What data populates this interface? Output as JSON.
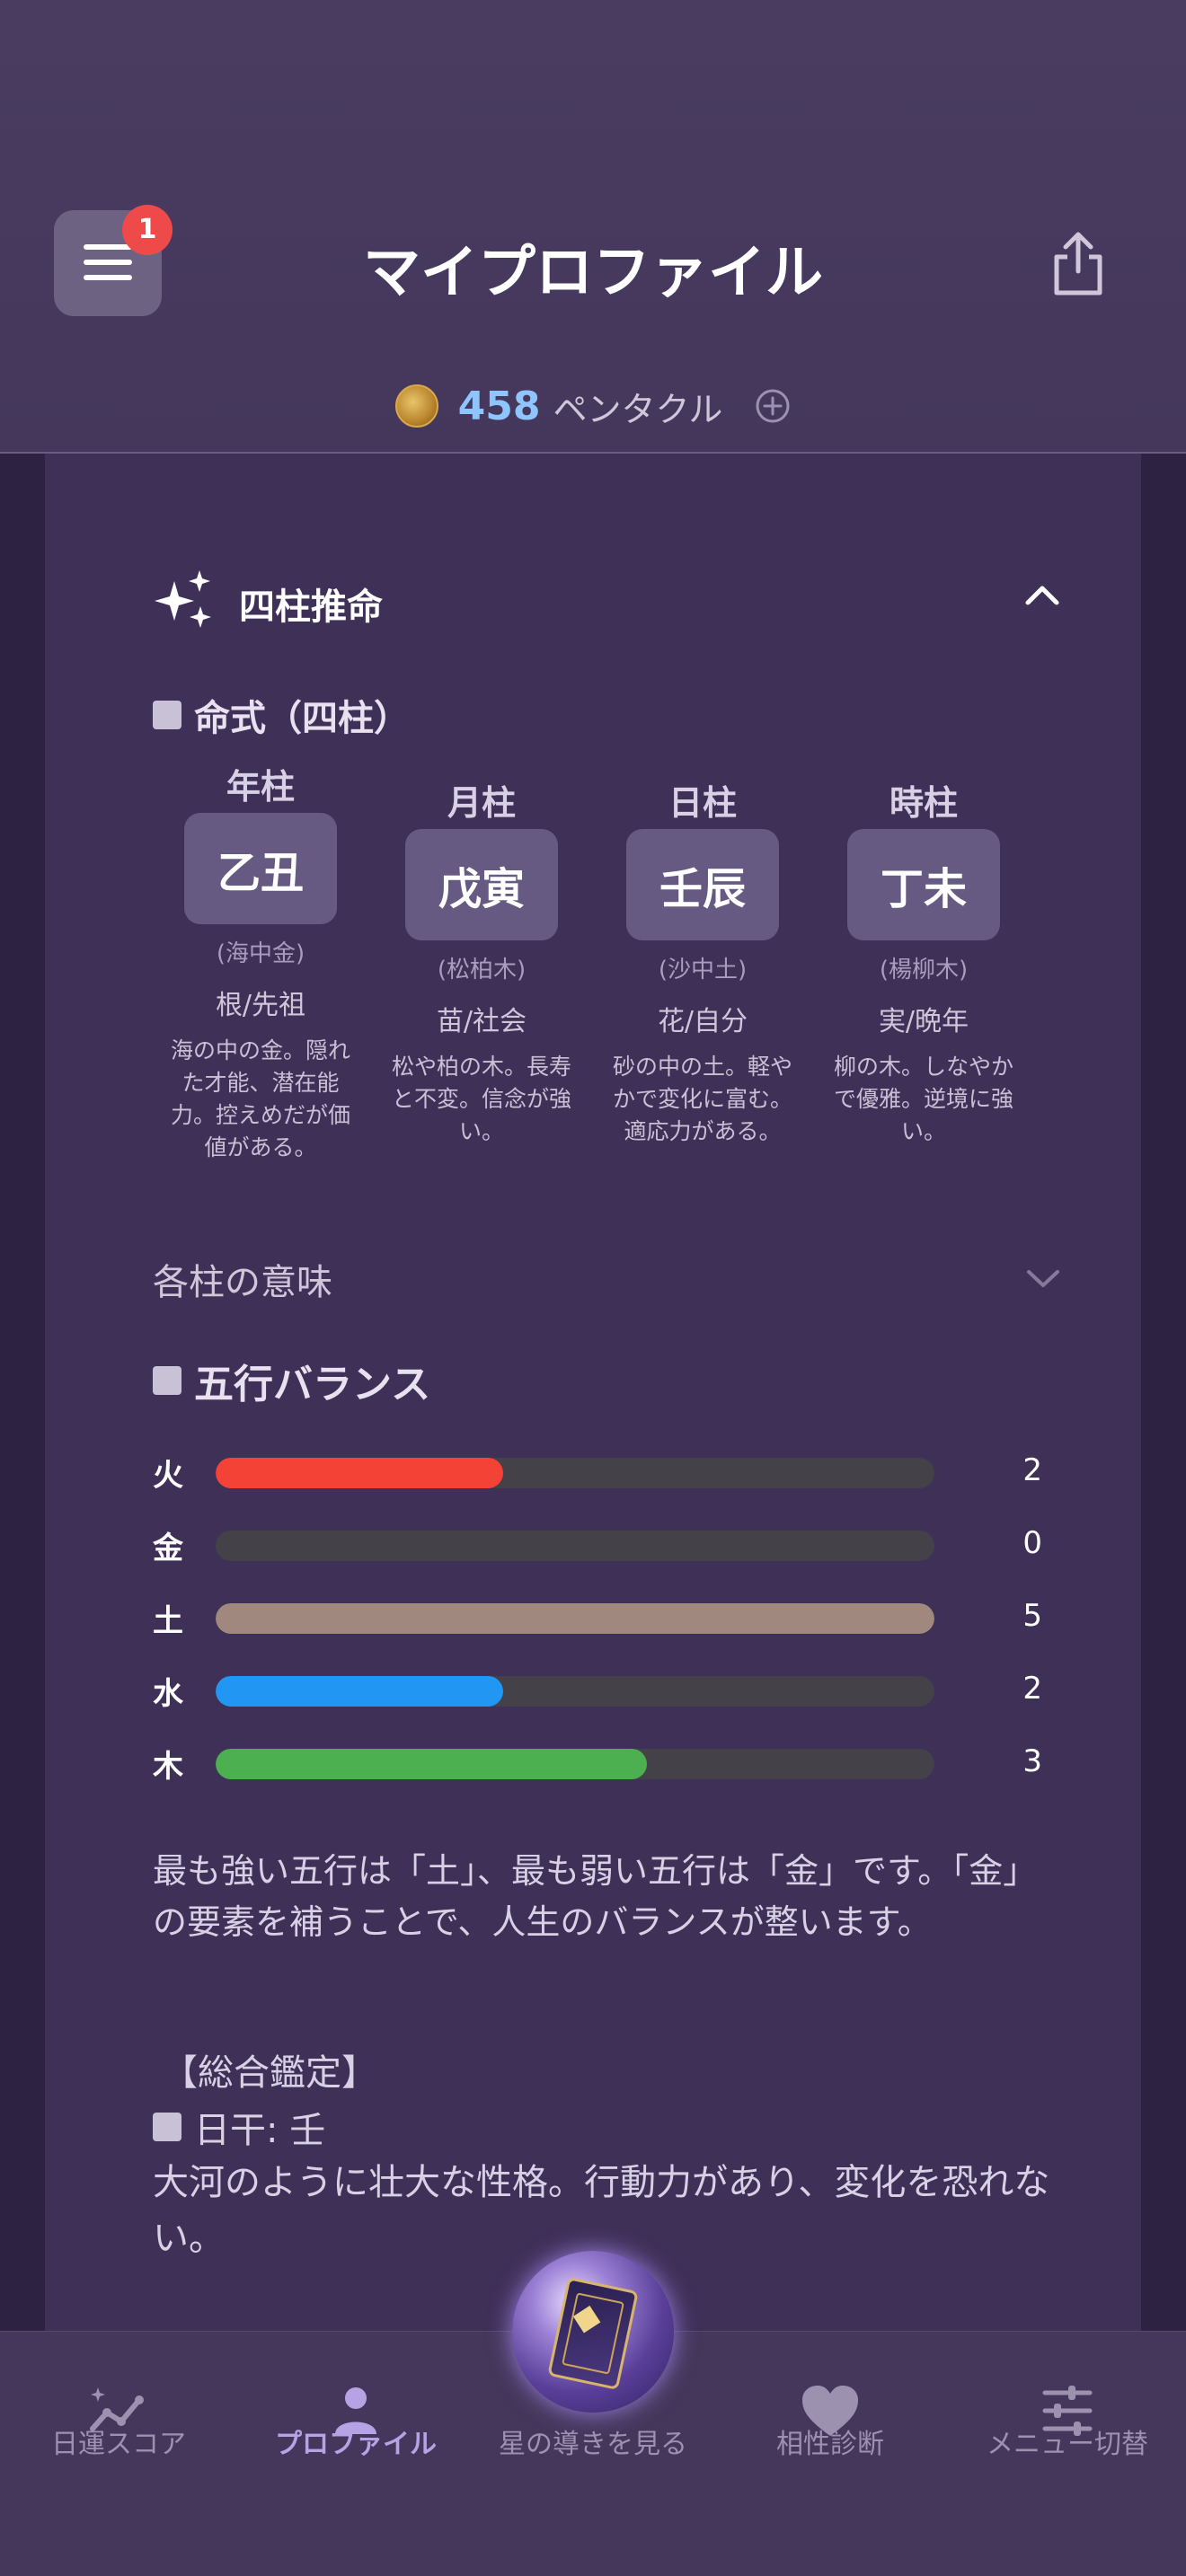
{
  "header": {
    "title": "マイプロファイル",
    "menu_badge": "1",
    "coins": {
      "count": "458",
      "label": "ペンタクル"
    }
  },
  "section": {
    "title": "四柱推命",
    "chart_title": "命式（四柱）",
    "pillars": [
      {
        "name": "年柱",
        "stem_branch": "乙丑",
        "element": "(海中金)",
        "meaning": "根/先祖",
        "desc": "海の中の金。隠れた才能、潜在能力。控えめだが価値がある。"
      },
      {
        "name": "月柱",
        "stem_branch": "戊寅",
        "element": "(松柏木)",
        "meaning": "苗/社会",
        "desc": "松や柏の木。長寿と不変。信念が強い。"
      },
      {
        "name": "日柱",
        "stem_branch": "壬辰",
        "element": "(沙中土)",
        "meaning": "花/自分",
        "desc": "砂の中の土。軽やかで変化に富む。適応力がある。"
      },
      {
        "name": "時柱",
        "stem_branch": "丁未",
        "element": "(楊柳木)",
        "meaning": "実/晩年",
        "desc": "柳の木。しなやかで優雅。逆境に強い。"
      }
    ],
    "pillar_meaning_label": "各柱の意味",
    "balance_title": "五行バランス",
    "balance": [
      {
        "label": "火",
        "value": 2,
        "color": "#f44336"
      },
      {
        "label": "金",
        "value": 0,
        "color": "#9e9e9e"
      },
      {
        "label": "土",
        "value": 5,
        "color": "#a1887f"
      },
      {
        "label": "水",
        "value": 2,
        "color": "#2196f3"
      },
      {
        "label": "木",
        "value": 3,
        "color": "#4caf50"
      }
    ],
    "balance_max": 5,
    "summary": "最も強い五行は「土」、最も弱い五行は「金」です。「金」の要素を補うことで、人生のバランスが整います。",
    "overall_title": "【総合鑑定】",
    "day_stem": "日干: 壬",
    "day_desc": "大河のように壮大な性格。行動力があり、変化を恐れない。"
  },
  "nav": {
    "items": [
      {
        "label": "日運スコア",
        "icon": "chart-sparkle-icon"
      },
      {
        "label": "プロファイル",
        "icon": "person-icon"
      },
      {
        "label": "星の導きを見る",
        "icon": "tarot-orb-icon"
      },
      {
        "label": "相性診断",
        "icon": "heart-icon"
      },
      {
        "label": "メニュー切替",
        "icon": "sliders-icon"
      }
    ]
  }
}
